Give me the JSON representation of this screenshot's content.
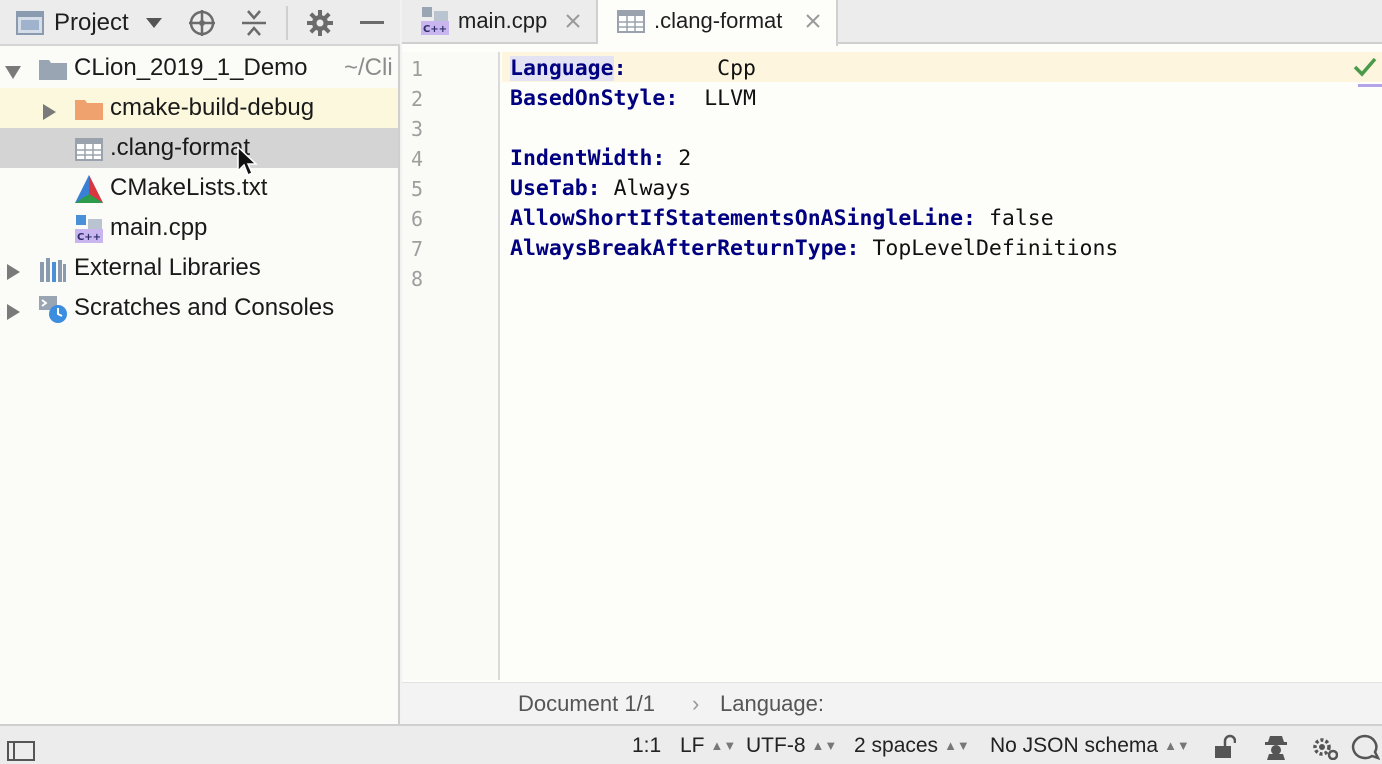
{
  "project_panel": {
    "title": "Project",
    "tree": {
      "root": {
        "name": "CLion_2019_1_Demo",
        "path": "~/Cli"
      },
      "cmake_build": "cmake-build-debug",
      "clang_format": ".clang-format",
      "cmakelists": "CMakeLists.txt",
      "main_cpp": "main.cpp",
      "external_libraries": "External Libraries",
      "scratches": "Scratches and Consoles"
    }
  },
  "tabs": [
    {
      "label": "main.cpp",
      "icon": "cpp-file-icon",
      "badge": "C++"
    },
    {
      "label": ".clang-format",
      "icon": "config-file-icon",
      "active": true
    }
  ],
  "editor": {
    "line_numbers": [
      "1",
      "2",
      "3",
      "4",
      "5",
      "6",
      "7",
      "8"
    ],
    "lines": [
      {
        "key": "Language",
        "sep": ":       ",
        "value": "Cpp"
      },
      {
        "key": "BasedOnStyle",
        "sep": ":  ",
        "value": "LLVM"
      },
      {
        "key": "",
        "sep": "",
        "value": ""
      },
      {
        "key": "IndentWidth",
        "sep": ": ",
        "value": "2"
      },
      {
        "key": "UseTab",
        "sep": ": ",
        "value": "Always"
      },
      {
        "key": "AllowShortIfStatementsOnASingleLine",
        "sep": ": ",
        "value": "false"
      },
      {
        "key": "AlwaysBreakAfterReturnType",
        "sep": ": ",
        "value": "TopLevelDefinitions"
      },
      {
        "key": "",
        "sep": "",
        "value": ""
      }
    ],
    "colors": {
      "key": "#000080",
      "caret_line": "#fdf5dd",
      "check": "#4a9a4a"
    }
  },
  "breadcrumb": {
    "document": "Document 1/1",
    "separator": "›",
    "item": "Language:"
  },
  "status_bar": {
    "position": "1:1",
    "line_separator": "LF",
    "encoding": "UTF-8",
    "indent": "2 spaces",
    "json_schema": "No JSON schema"
  }
}
